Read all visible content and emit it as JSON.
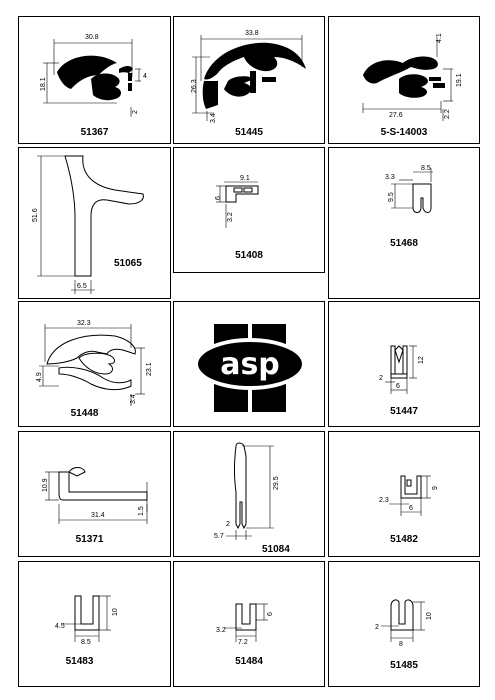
{
  "brand": {
    "logo_text": "asp"
  },
  "profiles": [
    {
      "code": "51367",
      "dims": [
        "30.8",
        "18.1",
        "4",
        "2"
      ]
    },
    {
      "code": "51445",
      "dims": [
        "33.8",
        "26.3",
        "3.4"
      ]
    },
    {
      "code": "5-S-14003",
      "dims": [
        "4.1",
        "19.1",
        "27.6",
        "2.2"
      ]
    },
    {
      "code": "51065",
      "dims": [
        "51.6",
        "6.5"
      ]
    },
    {
      "code": "51408",
      "dims": [
        "9.1",
        "6",
        "3.2"
      ]
    },
    {
      "code": "51468",
      "dims": [
        "3.3",
        "8.5",
        "9.5"
      ]
    },
    {
      "code": "51448",
      "dims": [
        "32.3",
        "4.9",
        "23.1",
        "3.4"
      ]
    },
    {
      "code": "51447",
      "dims": [
        "12",
        "2",
        "6"
      ]
    },
    {
      "code": "51371",
      "dims": [
        "10.9",
        "31.4",
        "1.5"
      ]
    },
    {
      "code": "51084",
      "dims": [
        "29.5",
        "2",
        "5.7"
      ]
    },
    {
      "code": "51482",
      "dims": [
        "2.3",
        "9",
        "6"
      ]
    },
    {
      "code": "51483",
      "dims": [
        "4.5",
        "10",
        "8.5"
      ]
    },
    {
      "code": "51484",
      "dims": [
        "3.2",
        "6",
        "7.2"
      ]
    },
    {
      "code": "51485",
      "dims": [
        "2",
        "10",
        "8"
      ]
    }
  ]
}
